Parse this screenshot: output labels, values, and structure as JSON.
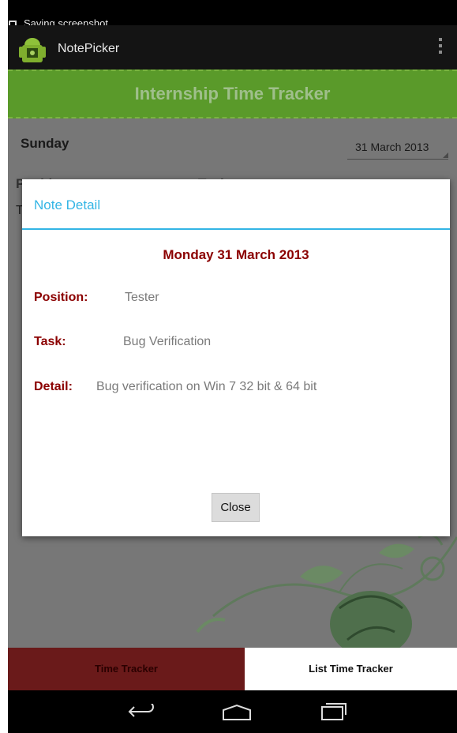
{
  "status_bar": {
    "notification_text": "Saving screenshot"
  },
  "action_bar": {
    "app_title": "NotePicker",
    "logo_icon": "android-app-icon",
    "overflow_icon": "overflow-menu-icon"
  },
  "banner": {
    "title": "Internship Time Tracker"
  },
  "main": {
    "day": "Sunday",
    "date_spinner": "31 March 2013",
    "col1_label": "Position",
    "col2_label": "Task",
    "row_letter": "T"
  },
  "dialog": {
    "title": "Note Detail",
    "date": "Monday 31 March 2013",
    "position_label": "Position:",
    "position_value": "Tester",
    "task_label": "Task:",
    "task_value": "Bug Verification",
    "detail_label": "Detail:",
    "detail_value": "Bug verification on Win 7 32 bit & 64 bit",
    "close_label": "Close",
    "accent_color": "#33b5e5",
    "label_color": "#8b0000"
  },
  "tabs": [
    {
      "label": "Time Tracker",
      "selected": true
    },
    {
      "label": "List Time Tracker",
      "selected": false
    }
  ],
  "nav_bar": {
    "back_icon": "back-icon",
    "home_icon": "home-icon",
    "recents_icon": "recent-apps-icon"
  }
}
